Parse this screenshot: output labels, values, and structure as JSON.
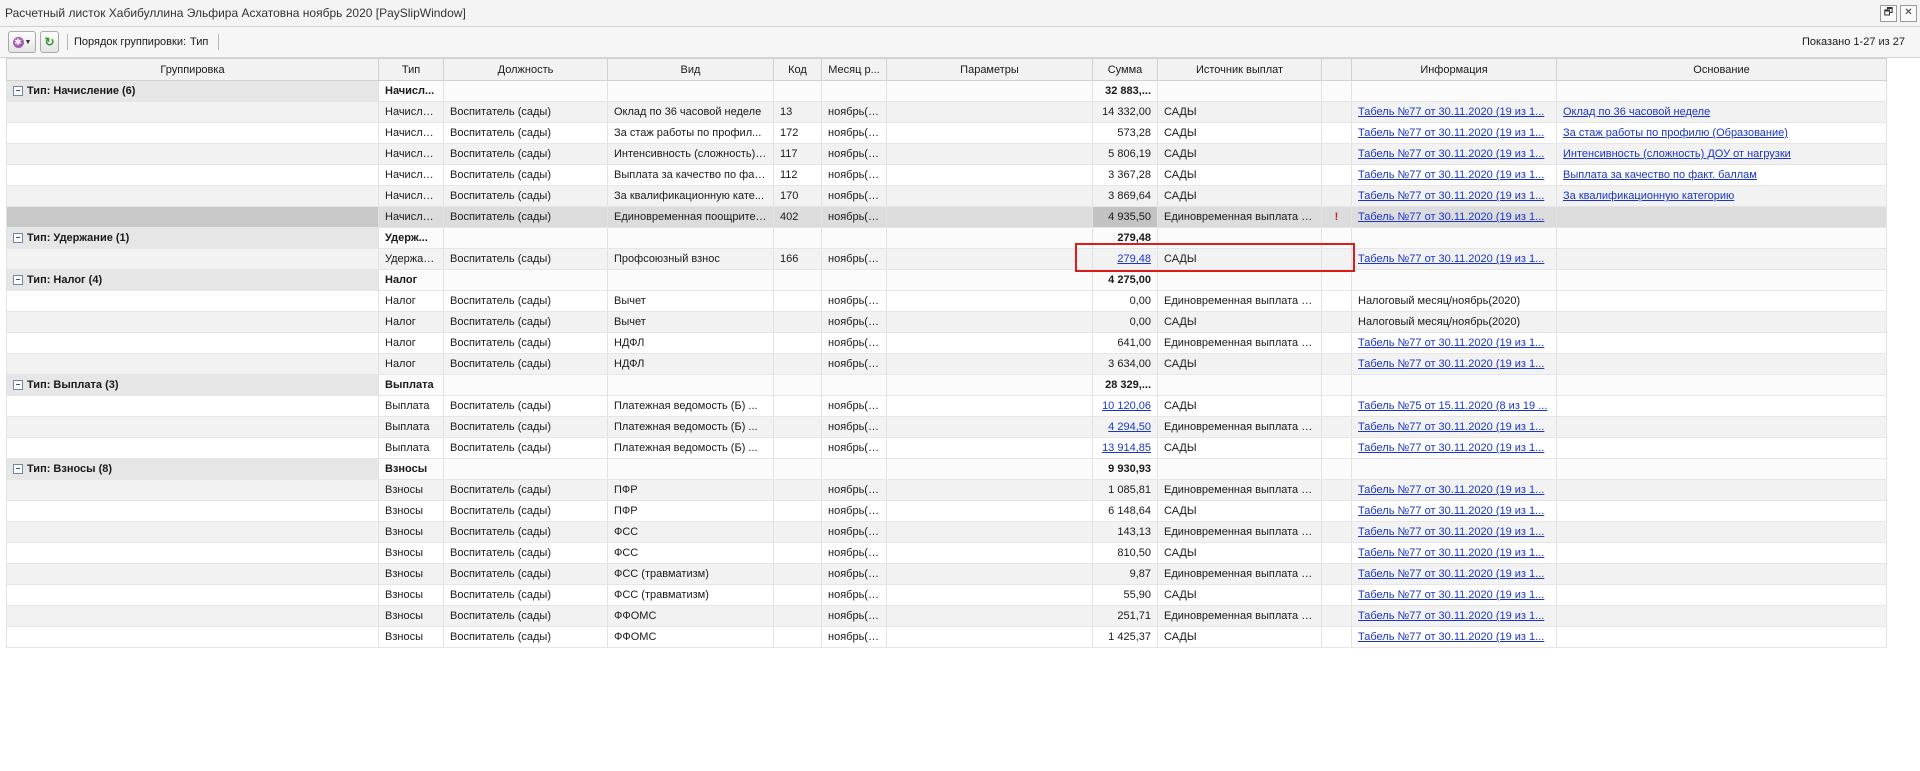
{
  "window": {
    "title": "Расчетный листок Хабибуллина Эльфира Асхатовна ноябрь 2020 [PaySlipWindow]",
    "restore_glyph": "🗗",
    "close_glyph": "✕"
  },
  "toolbar": {
    "gear_icon": "✱",
    "caret": "▼",
    "refresh_icon": "↻",
    "group_label": "Порядок группировки:",
    "group_value": "Тип",
    "shown": "Показано 1-27 из 27"
  },
  "columns": [
    "Группировка",
    "Тип",
    "Должность",
    "Вид",
    "Код",
    "Месяц р...",
    "Параметры",
    "Сумма",
    "Источник выплат",
    "",
    "Информация",
    "Основание"
  ],
  "groups": [
    {
      "label": "Тип: Начисление (6)",
      "type": "Начисл...",
      "sum": "32 883,...",
      "rows": [
        {
          "type": "Начисле...",
          "position": "Воспитатель (сады)",
          "kind": "Оклад по 36 часовой неделе",
          "code": "13",
          "month": "ноябрь(2...",
          "params": "",
          "sum": "14 332,00",
          "source": "САДЫ",
          "flag": "",
          "info": "Табель №77 от 30.11.2020 (19 из 1...",
          "basis": "Оклад по 36 часовой неделе"
        },
        {
          "type": "Начисле...",
          "position": "Воспитатель (сады)",
          "kind": "За стаж работы по профил...",
          "code": "172",
          "month": "ноябрь(2...",
          "params": "",
          "sum": "573,28",
          "source": "САДЫ",
          "flag": "",
          "info": "Табель №77 от 30.11.2020 (19 из 1...",
          "basis": "За стаж работы по профилю (Образование)"
        },
        {
          "type": "Начисле...",
          "position": "Воспитатель (сады)",
          "kind": "Интенсивность (сложность) ...",
          "code": "117",
          "month": "ноябрь(2...",
          "params": "",
          "sum": "5 806,19",
          "source": "САДЫ",
          "flag": "",
          "info": "Табель №77 от 30.11.2020 (19 из 1...",
          "basis": "Интенсивность (сложность) ДОУ от нагрузки"
        },
        {
          "type": "Начисле...",
          "position": "Воспитатель (сады)",
          "kind": "Выплата за качество по фак...",
          "code": "112",
          "month": "ноябрь(2...",
          "params": "",
          "sum": "3 367,28",
          "source": "САДЫ",
          "flag": "",
          "info": "Табель №77 от 30.11.2020 (19 из 1...",
          "basis": "Выплата за качество по факт. баллам"
        },
        {
          "type": "Начисле...",
          "position": "Воспитатель (сады)",
          "kind": "За квалификационную кате...",
          "code": "170",
          "month": "ноябрь(2...",
          "params": "",
          "sum": "3 869,64",
          "source": "САДЫ",
          "flag": "",
          "info": "Табель №77 от 30.11.2020 (19 из 1...",
          "basis": "За квалификационную категорию"
        },
        {
          "type": "Начисле...",
          "position": "Воспитатель (сады)",
          "kind": "Единовременная поощрител...",
          "code": "402",
          "month": "ноябрь(2...",
          "params": "",
          "sum": "4 935,50",
          "source": "Единовременная выплата с...",
          "flag": "!",
          "info": "Табель №77 от 30.11.2020 (19 из 1...",
          "basis": "",
          "selected": true
        }
      ]
    },
    {
      "label": "Тип: Удержание (1)",
      "type": "Удерж...",
      "sum": "279,48",
      "rows": [
        {
          "type": "Удержан...",
          "position": "Воспитатель (сады)",
          "kind": "Профсоюзный взнос",
          "code": "166",
          "month": "ноябрь(2...",
          "params": "",
          "sum": "279,48",
          "sum_link": true,
          "source": "САДЫ",
          "flag": "",
          "info": "Табель №77 от 30.11.2020 (19 из 1...",
          "basis": ""
        }
      ]
    },
    {
      "label": "Тип: Налог (4)",
      "type": "Налог",
      "sum": "4 275,00",
      "rows": [
        {
          "type": "Налог",
          "position": "Воспитатель (сады)",
          "kind": "Вычет",
          "code": "",
          "month": "ноябрь(2...",
          "params": "",
          "sum": "0,00",
          "source": "Единовременная выплата с...",
          "flag": "",
          "info": "Налоговый месяц/ноябрь(2020)",
          "info_plain": true,
          "basis": ""
        },
        {
          "type": "Налог",
          "position": "Воспитатель (сады)",
          "kind": "Вычет",
          "code": "",
          "month": "ноябрь(2...",
          "params": "",
          "sum": "0,00",
          "source": "САДЫ",
          "flag": "",
          "info": "Налоговый месяц/ноябрь(2020)",
          "info_plain": true,
          "basis": ""
        },
        {
          "type": "Налог",
          "position": "Воспитатель (сады)",
          "kind": "НДФЛ",
          "code": "",
          "month": "ноябрь(2...",
          "params": "",
          "sum": "641,00",
          "source": "Единовременная выплата с...",
          "flag": "",
          "info": "Табель №77 от 30.11.2020 (19 из 1...",
          "basis": ""
        },
        {
          "type": "Налог",
          "position": "Воспитатель (сады)",
          "kind": "НДФЛ",
          "code": "",
          "month": "ноябрь(2...",
          "params": "",
          "sum": "3 634,00",
          "source": "САДЫ",
          "flag": "",
          "info": "Табель №77 от 30.11.2020 (19 из 1...",
          "basis": ""
        }
      ]
    },
    {
      "label": "Тип: Выплата (3)",
      "type": "Выплата",
      "sum": "28 329,...",
      "rows": [
        {
          "type": "Выплата",
          "position": "Воспитатель (сады)",
          "kind": "Платежная ведомость (Б) ...",
          "code": "",
          "month": "ноябрь(2...",
          "params": "",
          "sum": "10 120,06",
          "sum_link": true,
          "source": "САДЫ",
          "flag": "",
          "info": "Табель №75 от 15.11.2020 (8 из 19 ...",
          "basis": ""
        },
        {
          "type": "Выплата",
          "position": "Воспитатель (сады)",
          "kind": "Платежная ведомость (Б) ...",
          "code": "",
          "month": "ноябрь(2...",
          "params": "",
          "sum": "4 294,50",
          "sum_link": true,
          "source": "Единовременная выплата с...",
          "flag": "",
          "info": "Табель №77 от 30.11.2020 (19 из 1...",
          "basis": ""
        },
        {
          "type": "Выплата",
          "position": "Воспитатель (сады)",
          "kind": "Платежная ведомость (Б) ...",
          "code": "",
          "month": "ноябрь(2...",
          "params": "",
          "sum": "13 914,85",
          "sum_link": true,
          "source": "САДЫ",
          "flag": "",
          "info": "Табель №77 от 30.11.2020 (19 из 1...",
          "basis": ""
        }
      ]
    },
    {
      "label": "Тип: Взносы (8)",
      "type": "Взносы",
      "sum": "9 930,93",
      "rows": [
        {
          "type": "Взносы",
          "position": "Воспитатель (сады)",
          "kind": "ПФР",
          "code": "",
          "month": "ноябрь(2...",
          "params": "",
          "sum": "1 085,81",
          "source": "Единовременная выплата с...",
          "flag": "",
          "info": "Табель №77 от 30.11.2020 (19 из 1...",
          "basis": ""
        },
        {
          "type": "Взносы",
          "position": "Воспитатель (сады)",
          "kind": "ПФР",
          "code": "",
          "month": "ноябрь(2...",
          "params": "",
          "sum": "6 148,64",
          "source": "САДЫ",
          "flag": "",
          "info": "Табель №77 от 30.11.2020 (19 из 1...",
          "basis": ""
        },
        {
          "type": "Взносы",
          "position": "Воспитатель (сады)",
          "kind": "ФСС",
          "code": "",
          "month": "ноябрь(2...",
          "params": "",
          "sum": "143,13",
          "source": "Единовременная выплата с...",
          "flag": "",
          "info": "Табель №77 от 30.11.2020 (19 из 1...",
          "basis": ""
        },
        {
          "type": "Взносы",
          "position": "Воспитатель (сады)",
          "kind": "ФСС",
          "code": "",
          "month": "ноябрь(2...",
          "params": "",
          "sum": "810,50",
          "source": "САДЫ",
          "flag": "",
          "info": "Табель №77 от 30.11.2020 (19 из 1...",
          "basis": ""
        },
        {
          "type": "Взносы",
          "position": "Воспитатель (сады)",
          "kind": "ФСС (травматизм)",
          "code": "",
          "month": "ноябрь(2...",
          "params": "",
          "sum": "9,87",
          "source": "Единовременная выплата с...",
          "flag": "",
          "info": "Табель №77 от 30.11.2020 (19 из 1...",
          "basis": ""
        },
        {
          "type": "Взносы",
          "position": "Воспитатель (сады)",
          "kind": "ФСС (травматизм)",
          "code": "",
          "month": "ноябрь(2...",
          "params": "",
          "sum": "55,90",
          "source": "САДЫ",
          "flag": "",
          "info": "Табель №77 от 30.11.2020 (19 из 1...",
          "basis": ""
        },
        {
          "type": "Взносы",
          "position": "Воспитатель (сады)",
          "kind": "ФФОМС",
          "code": "",
          "month": "ноябрь(2...",
          "params": "",
          "sum": "251,71",
          "source": "Единовременная выплата с...",
          "flag": "",
          "info": "Табель №77 от 30.11.2020 (19 из 1...",
          "basis": ""
        },
        {
          "type": "Взносы",
          "position": "Воспитатель (сады)",
          "kind": "ФФОМС",
          "code": "",
          "month": "ноябрь(2...",
          "params": "",
          "sum": "1 425,37",
          "source": "САДЫ",
          "flag": "",
          "info": "Табель №77 от 30.11.2020 (19 из 1...",
          "basis": ""
        }
      ]
    }
  ]
}
